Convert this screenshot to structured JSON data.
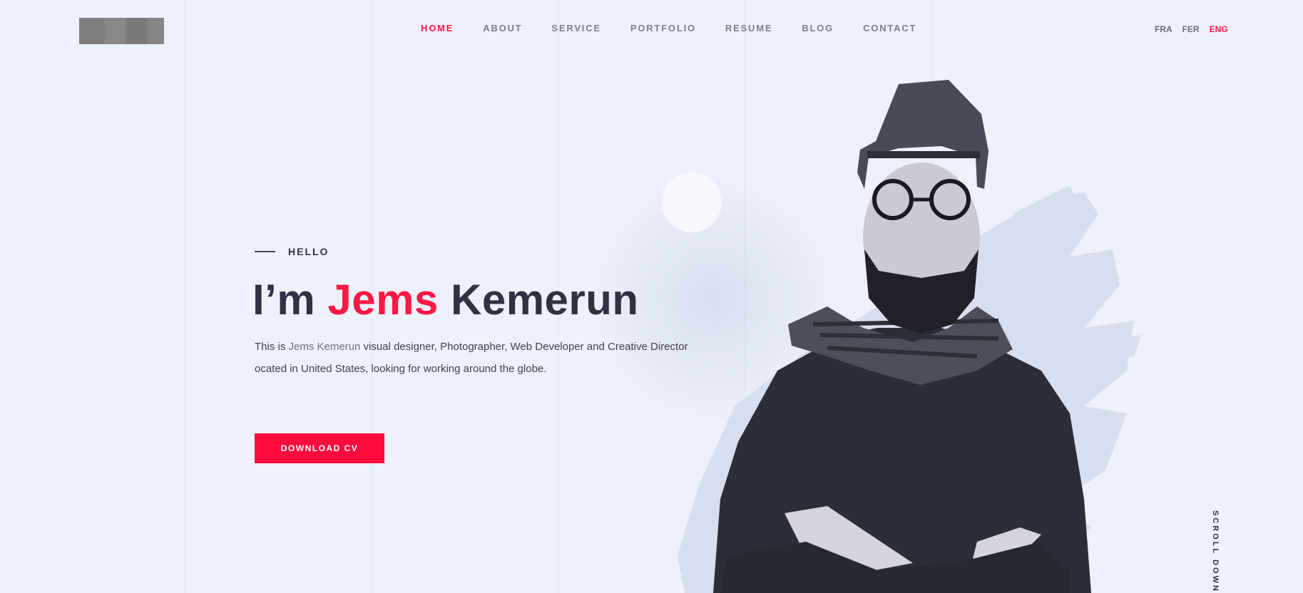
{
  "nav": {
    "items": [
      {
        "label": "HOME",
        "active": true
      },
      {
        "label": "ABOUT"
      },
      {
        "label": "SERVICE"
      },
      {
        "label": "PORTFOLIO"
      },
      {
        "label": "RESUME"
      },
      {
        "label": "BLOG"
      },
      {
        "label": "CONTACT"
      }
    ]
  },
  "languages": [
    {
      "label": "FRA"
    },
    {
      "label": "FER"
    },
    {
      "label": "ENG",
      "active": true
    }
  ],
  "hero": {
    "eyebrow": "HELLO",
    "headline_prefix": "I’m ",
    "headline_name_accent": "Jems",
    "headline_name_rest": " Kemerun",
    "desc_prefix": "This is ",
    "desc_name": "Jems Kemerun",
    "desc_line1_rest": " visual designer, Photographer, Web Developer and Creative Director",
    "desc_line2": "ocated in United States, looking for working around the globe.",
    "cta_label": "DOWNLOAD CV"
  },
  "scroll_label": "SCROLL DOWN",
  "colors": {
    "accent": "#ff1744",
    "background": "#edf1fc",
    "text": "#2e3243"
  },
  "icons": {
    "portrait": "person-photo"
  }
}
